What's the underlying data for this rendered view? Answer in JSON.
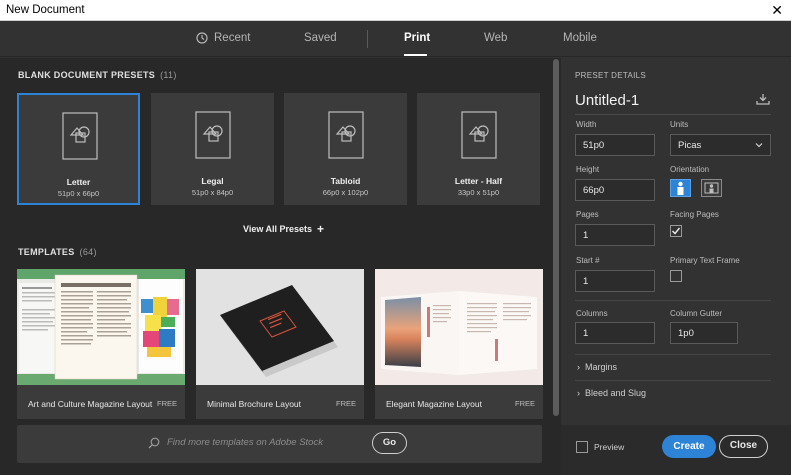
{
  "window": {
    "title": "New Document",
    "close_glyph": "✕"
  },
  "tabs": [
    {
      "label": "Recent",
      "icon": "clock-icon"
    },
    {
      "label": "Saved"
    },
    {
      "label": "Print",
      "active": true
    },
    {
      "label": "Web"
    },
    {
      "label": "Mobile"
    }
  ],
  "presets": {
    "title": "BLANK DOCUMENT PRESETS",
    "count": "(11)",
    "items": [
      {
        "name": "Letter",
        "size": "51p0 x 66p0",
        "selected": true
      },
      {
        "name": "Legal",
        "size": "51p0 x 84p0"
      },
      {
        "name": "Tabloid",
        "size": "66p0 x 102p0"
      },
      {
        "name": "Letter - Half",
        "size": "33p0 x 51p0"
      }
    ],
    "view_all": "View All Presets",
    "view_all_glyph": "+"
  },
  "templates": {
    "title": "TEMPLATES",
    "count": "(64)",
    "items": [
      {
        "name": "Art and Culture Magazine Layout",
        "badge": "FREE"
      },
      {
        "name": "Minimal Brochure Layout",
        "badge": "FREE"
      },
      {
        "name": "Elegant Magazine Layout",
        "badge": "FREE"
      }
    ]
  },
  "stock": {
    "placeholder": "Find more templates on Adobe Stock",
    "go": "Go"
  },
  "details": {
    "title": "PRESET DETAILS",
    "doc_name": "Untitled-1",
    "width_label": "Width",
    "width": "51p0",
    "units_label": "Units",
    "units": "Picas",
    "height_label": "Height",
    "height": "66p0",
    "orientation_label": "Orientation",
    "orientation": "portrait",
    "pages_label": "Pages",
    "pages": "1",
    "facing_label": "Facing Pages",
    "facing_checked": true,
    "start_label": "Start #",
    "start": "1",
    "primary_label": "Primary Text Frame",
    "primary_checked": false,
    "columns_label": "Columns",
    "columns": "1",
    "gutter_label": "Column Gutter",
    "gutter": "1p0",
    "margins": "Margins",
    "bleed": "Bleed and Slug",
    "expand_glyph": "›",
    "preview_label": "Preview",
    "preview_checked": false,
    "create": "Create",
    "close": "Close"
  },
  "colors": {
    "accent": "#2d83d6",
    "panel": "#323232",
    "content": "#282828",
    "card": "#3b3b3b"
  }
}
